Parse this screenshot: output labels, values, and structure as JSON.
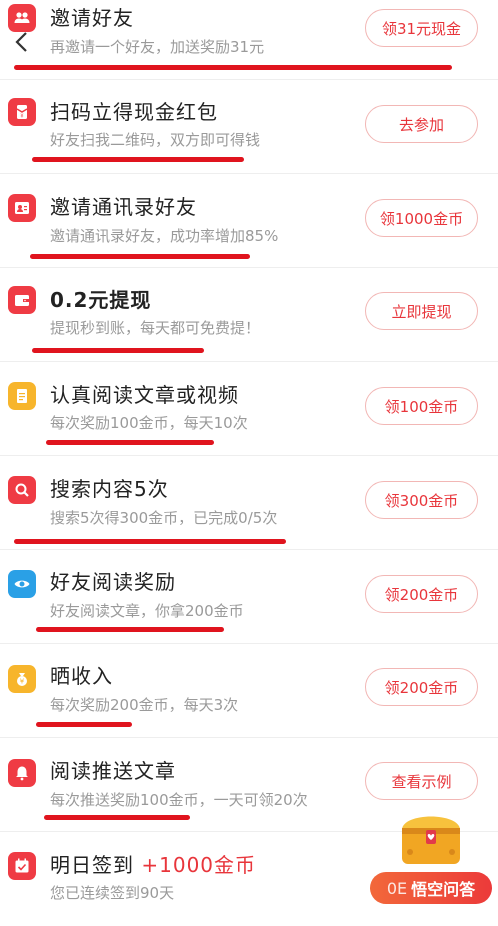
{
  "colors": {
    "accent": "#e8353b",
    "underline": "#e0141e"
  },
  "tasks": [
    {
      "icon": "users-icon",
      "icon_color": "#ef3b44",
      "title": "邀请好友",
      "subtitle": "再邀请一个好友，加送奖励31元",
      "button": "领31元现金"
    },
    {
      "icon": "red-envelope-icon",
      "icon_color": "#ef3b44",
      "title": "扫码立得现金红包",
      "subtitle": "好友扫我二维码，双方即可得钱",
      "button": "去参加"
    },
    {
      "icon": "contact-card-icon",
      "icon_color": "#ef3b44",
      "title": "邀请通讯录好友",
      "subtitle": "邀请通讯录好友，成功率增加85%",
      "button": "领1000金币"
    },
    {
      "icon": "wallet-icon",
      "icon_color": "#ef3b44",
      "title": "0.2元提现",
      "subtitle": "提现秒到账，每天都可免费提！",
      "button": "立即提现"
    },
    {
      "icon": "document-icon",
      "icon_color": "#f7b52c",
      "title": "认真阅读文章或视频",
      "subtitle": "每次奖励100金币，每天10次",
      "button": "领100金币"
    },
    {
      "icon": "search-icon",
      "icon_color": "#ef3b44",
      "title": "搜索内容5次",
      "subtitle": "搜索5次得300金币，已完成0/5次",
      "button": "领300金币"
    },
    {
      "icon": "eye-icon",
      "icon_color": "#2aa0e6",
      "title": "好友阅读奖励",
      "subtitle": "好友阅读文章，你拿200金币",
      "button": "领200金币"
    },
    {
      "icon": "money-bag-icon",
      "icon_color": "#f7b52c",
      "title": "晒收入",
      "subtitle": "每次奖励200金币，每天3次",
      "button": "领200金币"
    },
    {
      "icon": "bell-icon",
      "icon_color": "#ef3b44",
      "title": "阅读推送文章",
      "subtitle": "每次推送奖励100金币，一天可领20次",
      "button": "查看示例"
    }
  ],
  "checkin": {
    "icon": "calendar-check-icon",
    "icon_color": "#ef3b44",
    "title": "明日签到",
    "reward": "+1000金币",
    "subtitle": "您已连续签到90天"
  },
  "badge": {
    "pill_prefix": "0E",
    "label": "悟空问答"
  }
}
